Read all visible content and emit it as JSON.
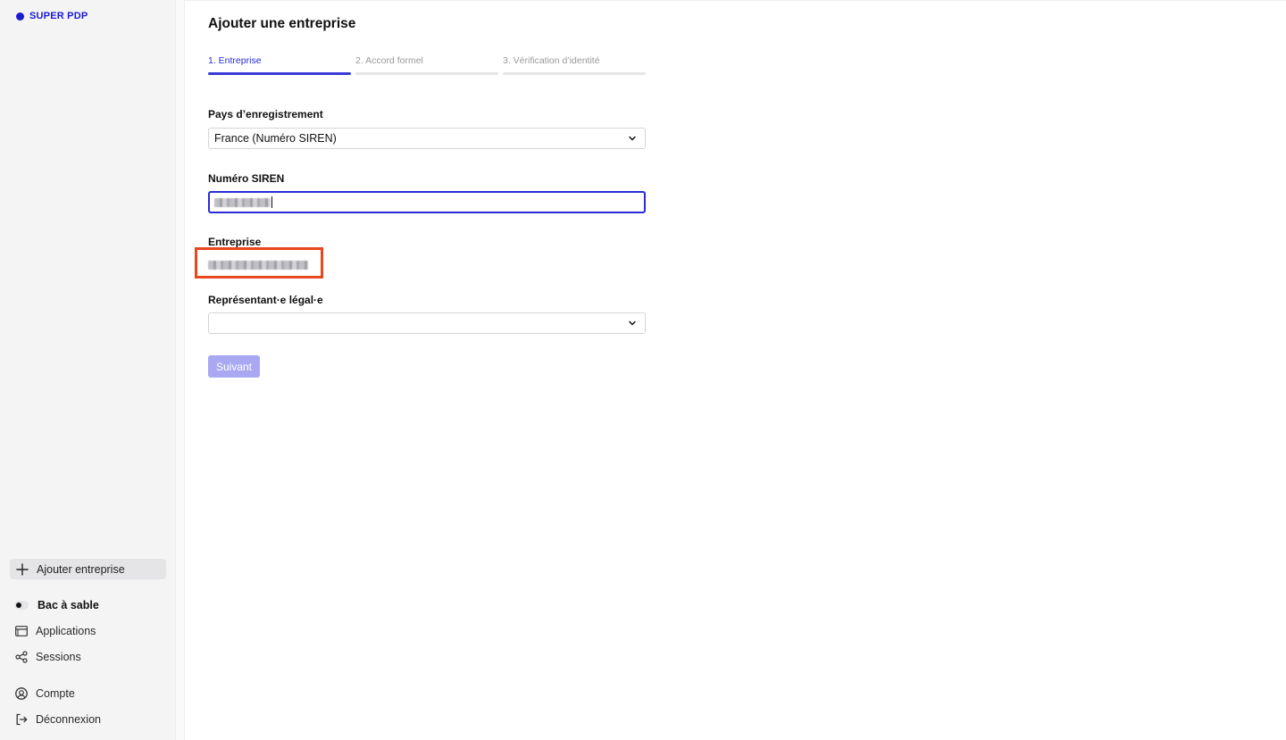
{
  "brand": {
    "name": "SUPER PDP",
    "color": "#1b1bd1"
  },
  "sidebar": {
    "add_company_label": "Ajouter entreprise",
    "sandbox_label": "Bac à sable",
    "items": [
      {
        "label": "Applications",
        "icon": "window-icon"
      },
      {
        "label": "Sessions",
        "icon": "share-nodes-icon"
      },
      {
        "label": "Compte",
        "icon": "user-circle-icon"
      },
      {
        "label": "Déconnexion",
        "icon": "logout-icon"
      }
    ]
  },
  "page": {
    "title": "Ajouter une entreprise"
  },
  "steps": [
    {
      "label": "1. Entreprise",
      "state": "active"
    },
    {
      "label": "2. Accord formel",
      "state": "inactive"
    },
    {
      "label": "3. Vérification d’identité",
      "state": "inactive"
    }
  ],
  "form": {
    "country_label": "Pays d’enregistrement",
    "country_value": "France (Numéro SIREN)",
    "siren_label": "Numéro SIREN",
    "siren_value": "blurred",
    "company_label": "Entreprise",
    "company_value": "blurred",
    "representative_label": "Représentant·e légal·e",
    "representative_value": "",
    "next_label": "Suivant"
  },
  "colors": {
    "accent": "#2b2bd6",
    "button_disabled": "#a9a9f3",
    "highlight": "#e8471f"
  }
}
